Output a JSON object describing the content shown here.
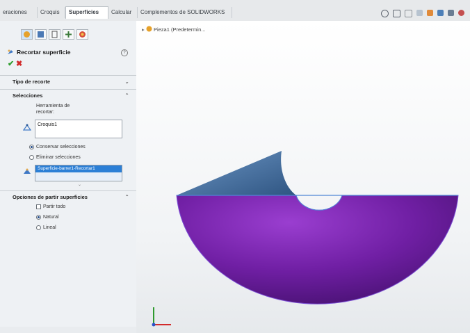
{
  "tabs": [
    "eraciones",
    "Croquis",
    "Superficies",
    "Calcular",
    "Complementos de SOLIDWORKS"
  ],
  "active_tab": "Superficies",
  "feature": {
    "title": "Recortar superficie",
    "help_icon": "?"
  },
  "sections": {
    "trim_type": "Tipo de recorte",
    "selections": "Selecciones",
    "split_options": "Opciones de partir superficies"
  },
  "selections": {
    "tool_label": "Herramienta de\nrecortar:",
    "tool_value": "Croquis1",
    "keep_selections": "Conservar selecciones",
    "remove_selections": "Eliminar selecciones",
    "list_item": "Superficie-barrer1-Recortar1"
  },
  "split_options": {
    "split_all": "Partir todo",
    "natural": "Natural",
    "linear": "Lineal"
  },
  "tree": {
    "part_label": "Pieza1 (Predetermin..."
  },
  "colors": {
    "accent": "#1f6fd1",
    "selected_fill": "#2b7fd6",
    "surface_blue": "#3d6491",
    "surface_purple": "#6a1b96"
  },
  "icons": [
    "feature-manager-icon",
    "property-manager-icon",
    "configuration-manager-icon",
    "dim-expert-icon",
    "display-manager-icon",
    "trim-surface-icon",
    "help-icon",
    "ok-icon",
    "cancel-icon",
    "sketch-icon",
    "surface-icon"
  ]
}
